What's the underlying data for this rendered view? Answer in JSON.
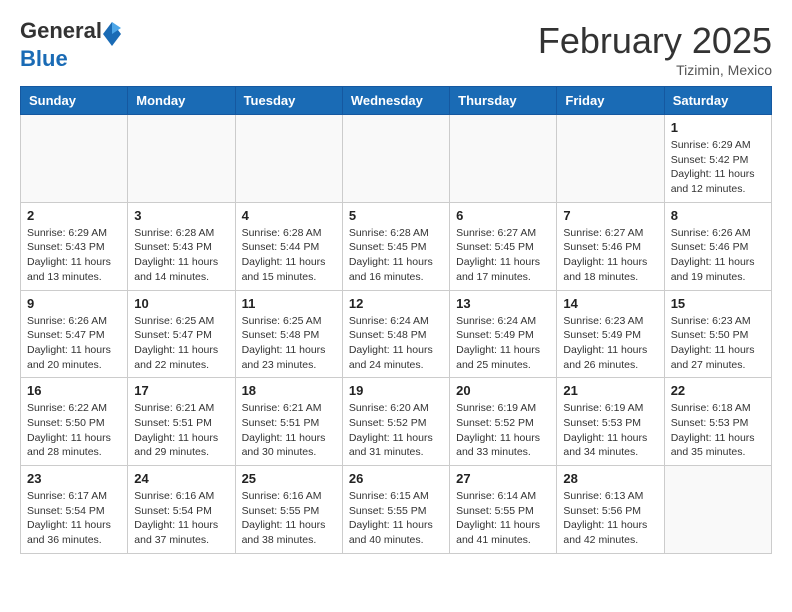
{
  "logo": {
    "general": "General",
    "blue": "Blue"
  },
  "title": "February 2025",
  "location": "Tizimin, Mexico",
  "days_of_week": [
    "Sunday",
    "Monday",
    "Tuesday",
    "Wednesday",
    "Thursday",
    "Friday",
    "Saturday"
  ],
  "weeks": [
    [
      {
        "day": "",
        "info": ""
      },
      {
        "day": "",
        "info": ""
      },
      {
        "day": "",
        "info": ""
      },
      {
        "day": "",
        "info": ""
      },
      {
        "day": "",
        "info": ""
      },
      {
        "day": "",
        "info": ""
      },
      {
        "day": "1",
        "info": "Sunrise: 6:29 AM\nSunset: 5:42 PM\nDaylight: 11 hours and 12 minutes."
      }
    ],
    [
      {
        "day": "2",
        "info": "Sunrise: 6:29 AM\nSunset: 5:43 PM\nDaylight: 11 hours and 13 minutes."
      },
      {
        "day": "3",
        "info": "Sunrise: 6:28 AM\nSunset: 5:43 PM\nDaylight: 11 hours and 14 minutes."
      },
      {
        "day": "4",
        "info": "Sunrise: 6:28 AM\nSunset: 5:44 PM\nDaylight: 11 hours and 15 minutes."
      },
      {
        "day": "5",
        "info": "Sunrise: 6:28 AM\nSunset: 5:45 PM\nDaylight: 11 hours and 16 minutes."
      },
      {
        "day": "6",
        "info": "Sunrise: 6:27 AM\nSunset: 5:45 PM\nDaylight: 11 hours and 17 minutes."
      },
      {
        "day": "7",
        "info": "Sunrise: 6:27 AM\nSunset: 5:46 PM\nDaylight: 11 hours and 18 minutes."
      },
      {
        "day": "8",
        "info": "Sunrise: 6:26 AM\nSunset: 5:46 PM\nDaylight: 11 hours and 19 minutes."
      }
    ],
    [
      {
        "day": "9",
        "info": "Sunrise: 6:26 AM\nSunset: 5:47 PM\nDaylight: 11 hours and 20 minutes."
      },
      {
        "day": "10",
        "info": "Sunrise: 6:25 AM\nSunset: 5:47 PM\nDaylight: 11 hours and 22 minutes."
      },
      {
        "day": "11",
        "info": "Sunrise: 6:25 AM\nSunset: 5:48 PM\nDaylight: 11 hours and 23 minutes."
      },
      {
        "day": "12",
        "info": "Sunrise: 6:24 AM\nSunset: 5:48 PM\nDaylight: 11 hours and 24 minutes."
      },
      {
        "day": "13",
        "info": "Sunrise: 6:24 AM\nSunset: 5:49 PM\nDaylight: 11 hours and 25 minutes."
      },
      {
        "day": "14",
        "info": "Sunrise: 6:23 AM\nSunset: 5:49 PM\nDaylight: 11 hours and 26 minutes."
      },
      {
        "day": "15",
        "info": "Sunrise: 6:23 AM\nSunset: 5:50 PM\nDaylight: 11 hours and 27 minutes."
      }
    ],
    [
      {
        "day": "16",
        "info": "Sunrise: 6:22 AM\nSunset: 5:50 PM\nDaylight: 11 hours and 28 minutes."
      },
      {
        "day": "17",
        "info": "Sunrise: 6:21 AM\nSunset: 5:51 PM\nDaylight: 11 hours and 29 minutes."
      },
      {
        "day": "18",
        "info": "Sunrise: 6:21 AM\nSunset: 5:51 PM\nDaylight: 11 hours and 30 minutes."
      },
      {
        "day": "19",
        "info": "Sunrise: 6:20 AM\nSunset: 5:52 PM\nDaylight: 11 hours and 31 minutes."
      },
      {
        "day": "20",
        "info": "Sunrise: 6:19 AM\nSunset: 5:52 PM\nDaylight: 11 hours and 33 minutes."
      },
      {
        "day": "21",
        "info": "Sunrise: 6:19 AM\nSunset: 5:53 PM\nDaylight: 11 hours and 34 minutes."
      },
      {
        "day": "22",
        "info": "Sunrise: 6:18 AM\nSunset: 5:53 PM\nDaylight: 11 hours and 35 minutes."
      }
    ],
    [
      {
        "day": "23",
        "info": "Sunrise: 6:17 AM\nSunset: 5:54 PM\nDaylight: 11 hours and 36 minutes."
      },
      {
        "day": "24",
        "info": "Sunrise: 6:16 AM\nSunset: 5:54 PM\nDaylight: 11 hours and 37 minutes."
      },
      {
        "day": "25",
        "info": "Sunrise: 6:16 AM\nSunset: 5:55 PM\nDaylight: 11 hours and 38 minutes."
      },
      {
        "day": "26",
        "info": "Sunrise: 6:15 AM\nSunset: 5:55 PM\nDaylight: 11 hours and 40 minutes."
      },
      {
        "day": "27",
        "info": "Sunrise: 6:14 AM\nSunset: 5:55 PM\nDaylight: 11 hours and 41 minutes."
      },
      {
        "day": "28",
        "info": "Sunrise: 6:13 AM\nSunset: 5:56 PM\nDaylight: 11 hours and 42 minutes."
      },
      {
        "day": "",
        "info": ""
      }
    ]
  ]
}
